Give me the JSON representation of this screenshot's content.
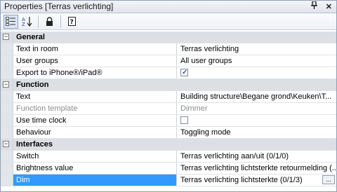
{
  "window": {
    "title": "Properties [Terras verlichting]",
    "pin_glyph": "ᵽ",
    "close_glyph": "✕"
  },
  "toolbar": {
    "categorized_icon": "categorized-view-icon",
    "alphabetical_icon": "alphabetical-sort-icon",
    "lock_icon": "lock-icon",
    "help_icon": "help-icon",
    "help_glyph": "?"
  },
  "categories": {
    "general": "General",
    "function": "Function",
    "interfaces": "Interfaces"
  },
  "rows": {
    "text_in_room": {
      "name": "Text in room",
      "value": "Terras verlichting"
    },
    "user_groups": {
      "name": "User groups",
      "value": "All user groups"
    },
    "export_iphone": {
      "name": "Export to iPhone®/iPad®",
      "checked": true
    },
    "text": {
      "name": "Text",
      "value": "Building structure\\Begane grond\\Keuken\\T..."
    },
    "function_template": {
      "name": "Function template",
      "value": "Dimmer"
    },
    "use_time_clock": {
      "name": "Use time clock",
      "checked": false
    },
    "behaviour": {
      "name": "Behaviour",
      "value": "Toggling mode"
    },
    "switch": {
      "name": "Switch",
      "value": "Terras verlichting aan/uit (0/1/0)"
    },
    "brightness_value": {
      "name": "Brightness value",
      "value": "Terras verlichting lichtsterkte retourmelding (..."
    },
    "dim": {
      "name": "Dim",
      "value": "Terras verlichting lichtsterkte (0/1/3)"
    }
  },
  "expander_glyph": "−",
  "ellipsis_glyph": "...",
  "colors": {
    "selection": "#3399ff",
    "category_bg": "#dcdfe4",
    "disabled_text": "#8c8c8c"
  }
}
